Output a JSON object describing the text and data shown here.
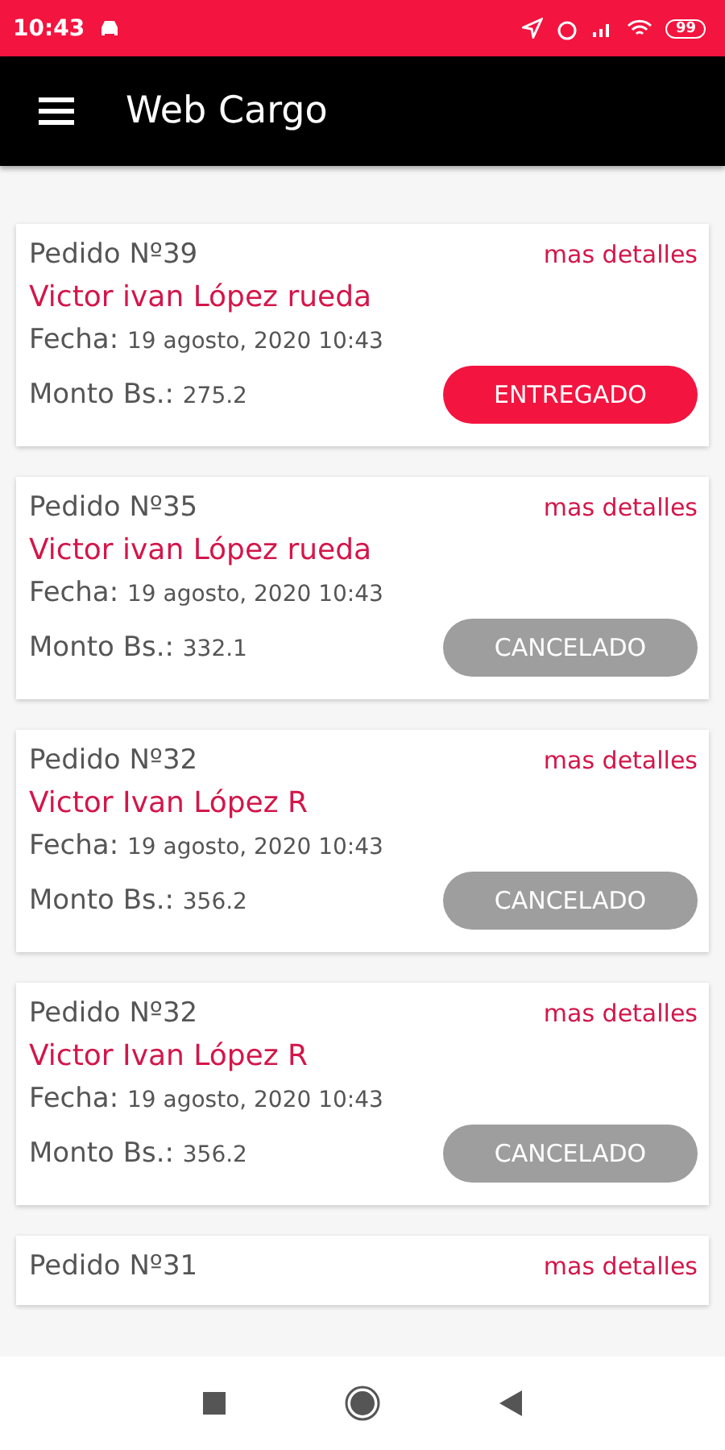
{
  "status_bar": {
    "time": "10:43",
    "battery": "99"
  },
  "app_bar": {
    "title": "Web Cargo"
  },
  "orders": [
    {
      "number": "Pedido Nº39",
      "link": "mas detalles",
      "customer": "Victor ivan López rueda",
      "date_label": "Fecha:",
      "date": "19 agosto, 2020 10:43",
      "amount_label": "Monto Bs.:",
      "amount": "275.2",
      "status": {
        "kind": "delivered",
        "label": "ENTREGADO"
      }
    },
    {
      "number": "Pedido Nº35",
      "link": "mas detalles",
      "customer": "Victor ivan López rueda",
      "date_label": "Fecha:",
      "date": "19 agosto, 2020 10:43",
      "amount_label": "Monto Bs.:",
      "amount": "332.1",
      "status": {
        "kind": "cancelled",
        "label": "CANCELADO"
      }
    },
    {
      "number": "Pedido Nº32",
      "link": "mas detalles",
      "customer": "Victor Ivan López R",
      "date_label": "Fecha:",
      "date": "19 agosto, 2020 10:43",
      "amount_label": "Monto Bs.:",
      "amount": "356.2",
      "status": {
        "kind": "cancelled",
        "label": "CANCELADO"
      }
    },
    {
      "number": "Pedido Nº32",
      "link": "mas detalles",
      "customer": "Victor Ivan López R",
      "date_label": "Fecha:",
      "date": "19 agosto, 2020 10:43",
      "amount_label": "Monto Bs.:",
      "amount": "356.2",
      "status": {
        "kind": "cancelled",
        "label": "CANCELADO"
      }
    },
    {
      "number": "Pedido Nº31",
      "link": "mas detalles"
    }
  ]
}
